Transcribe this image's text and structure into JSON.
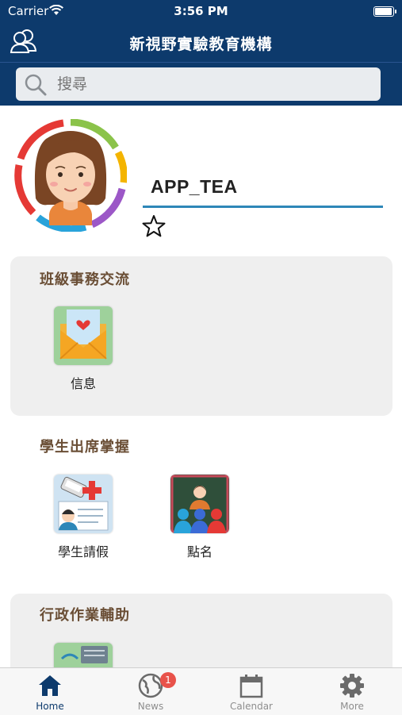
{
  "status_bar": {
    "carrier": "Carrier",
    "time": "3:56 PM"
  },
  "nav": {
    "title": "新視野實驗教育機構"
  },
  "search": {
    "placeholder": "搜尋"
  },
  "profile": {
    "username": "APP_TEA"
  },
  "sections": [
    {
      "title": "班級事務交流",
      "items": [
        {
          "label": "信息"
        }
      ]
    },
    {
      "title": "學生出席掌握",
      "items": [
        {
          "label": "學生請假"
        },
        {
          "label": "點名"
        }
      ]
    },
    {
      "title": "行政作業輔助",
      "items": []
    }
  ],
  "tabs": [
    {
      "label": "Home",
      "active": true
    },
    {
      "label": "News",
      "badge": "1"
    },
    {
      "label": "Calendar"
    },
    {
      "label": "More"
    }
  ],
  "colors": {
    "brand": "#0d3a6c",
    "accent": "#2e87b8",
    "badge": "#e8524a"
  }
}
